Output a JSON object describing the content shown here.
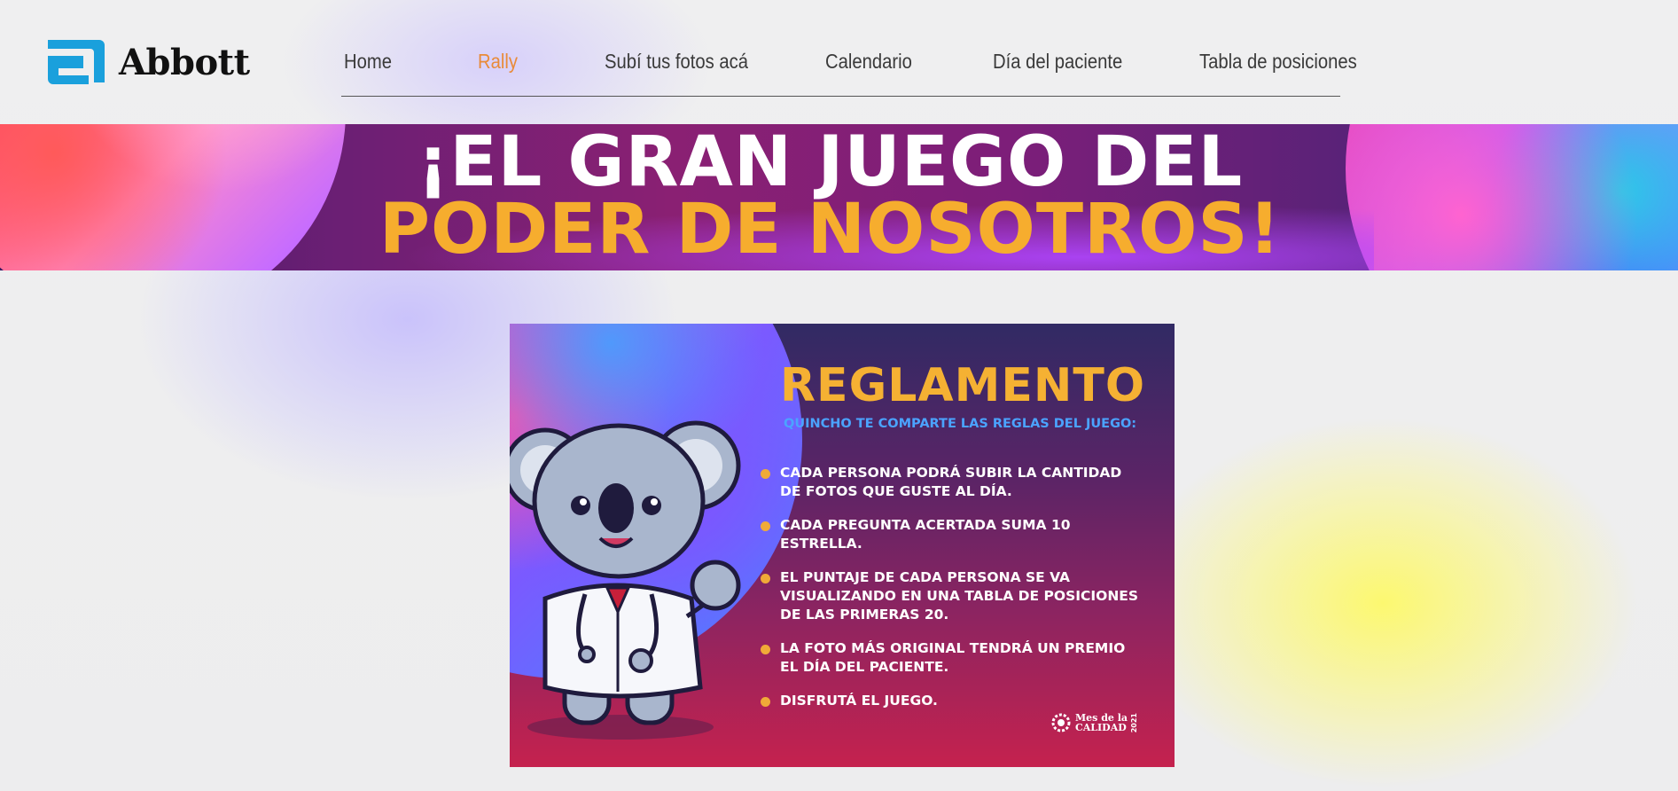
{
  "brand": {
    "name": "Abbott"
  },
  "nav": {
    "items": [
      {
        "label": "Home",
        "active": false
      },
      {
        "label": "Rally",
        "active": true
      },
      {
        "label": "Subí tus fotos acá",
        "active": false
      },
      {
        "label": "Calendario",
        "active": false
      },
      {
        "label": "Día del paciente",
        "active": false
      },
      {
        "label": "Tabla de posiciones",
        "active": false
      }
    ],
    "active_color": "#e98b39"
  },
  "banner": {
    "line1": "¡EL GRAN JUEGO DEL",
    "line2": "PODER DE NOSOTROS!"
  },
  "poster": {
    "title": "REGLAMENTO",
    "subtitle": "QUINCHO TE COMPARTE LAS REGLAS DEL JUEGO:",
    "rules": [
      "CADA PERSONA PODRÁ SUBIR LA CANTIDAD\nDE FOTOS QUE GUSTE AL DÍA.",
      "CADA PREGUNTA ACERTADA SUMA 10 ESTRELLA.",
      "EL PUNTAJE DE CADA PERSONA SE VA\nVISUALIZANDO EN UNA TABLA DE POSICIONES\nDE LAS PRIMERAS 20.",
      "LA FOTO MÁS ORIGINAL TENDRÁ UN PREMIO\nEL DÍA DEL PACIENTE.",
      "DISFRUTÁ EL JUEGO."
    ],
    "badge": {
      "line1": "Mes de la",
      "line2": "CALIDAD",
      "year": "2021"
    }
  }
}
